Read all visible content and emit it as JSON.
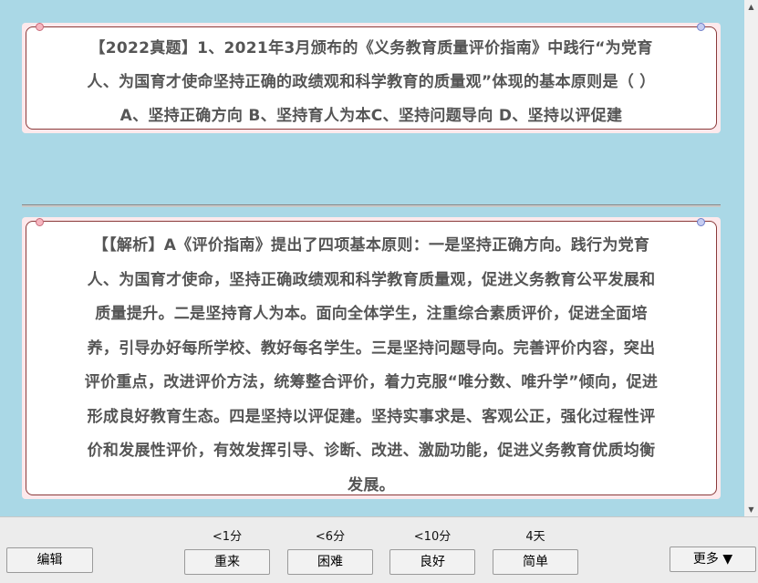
{
  "question": {
    "lines": [
      "【2022真题】1、2021年3月颁布的《义务教育质量评价指南》中践行“为党育",
      "人、为国育才使命坚持正确的政绩观和科学教育的质量观”体现的基本原则是（ ）",
      "A、坚持正确方向 B、坚持育人为本C、坚持问题导向 D、坚持以评促建"
    ]
  },
  "answer": {
    "lines": [
      "【【解析】A《评价指南》提出了四项基本原则：一是坚持正确方向。践行为党育",
      "人、为国育才使命，坚持正确政绩观和科学教育质量观，促进义务教育公平发展和",
      "质量提升。二是坚持育人为本。面向全体学生，注重综合素质评价，促进全面培",
      "养，引导办好每所学校、教好每名学生。三是坚持问题导向。完善评价内容，突出",
      "评价重点，改进评价方法，统筹整合评价，着力克服“唯分数、唯升学”倾向，促进",
      "形成良好教育生态。四是坚持以评促建。坚持实事求是、客观公正，强化过程性评",
      "价和发展性评价，有效发挥引导、诊断、改进、激励功能，促进义务教育优质均衡",
      "发展。"
    ]
  },
  "toolbar": {
    "edit_label": "编辑",
    "more_label": "更多 ▼",
    "ratings": [
      {
        "interval": "<1分",
        "label": "重来"
      },
      {
        "interval": "<6分",
        "label": "困难"
      },
      {
        "interval": "<10分",
        "label": "良好"
      },
      {
        "interval": "4天",
        "label": "简单"
      }
    ]
  },
  "colors": {
    "background": "#aad8e6",
    "card_border": "#8b3a3a",
    "text": "#555555"
  }
}
